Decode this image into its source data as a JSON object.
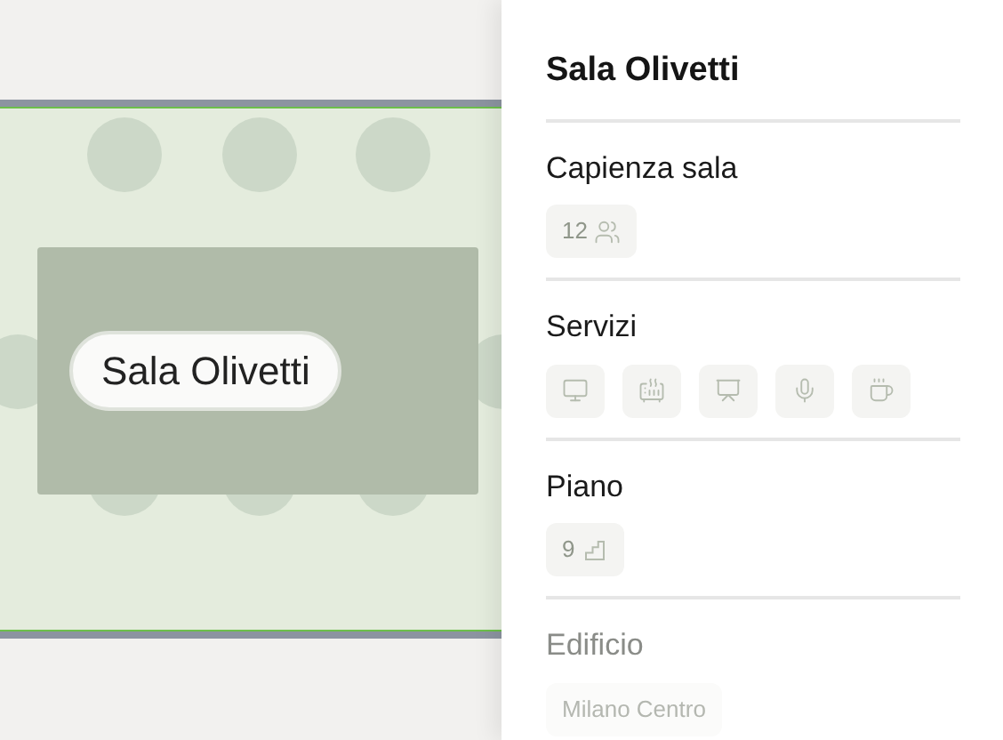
{
  "room_label": "Sala Olivetti",
  "panel": {
    "title": "Sala Olivetti",
    "sections": [
      {
        "label": "Capienza sala",
        "kind": "chips",
        "chips": [
          {
            "text": "12",
            "kind": "people"
          }
        ]
      },
      {
        "label": "Servizi",
        "kind": "chips",
        "chips": [
          {
            "kind": "monitor"
          },
          {
            "kind": "heater"
          },
          {
            "kind": "presentation"
          },
          {
            "kind": "mic"
          },
          {
            "kind": "coffee"
          }
        ]
      },
      {
        "label": "Piano",
        "kind": "chips",
        "chips": [
          {
            "text": "9",
            "kind": "stairs"
          }
        ]
      },
      {
        "label": "Edificio",
        "kind": "faded",
        "chips": [
          {
            "text": "Milano Centro"
          }
        ]
      }
    ]
  }
}
